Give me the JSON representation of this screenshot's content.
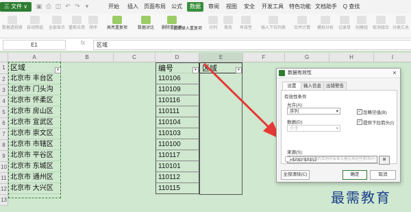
{
  "titlebar": {
    "file_menu": "三 文件 ∨",
    "tabs": [
      {
        "label": "开始"
      },
      {
        "label": "插入"
      },
      {
        "label": "页面布局"
      },
      {
        "label": "公式"
      },
      {
        "label": "数据"
      },
      {
        "label": "审阅"
      },
      {
        "label": "视图"
      },
      {
        "label": "安全"
      },
      {
        "label": "开发工具"
      },
      {
        "label": "特色功能"
      },
      {
        "label": "文档助手"
      },
      {
        "label": "Q 查找"
      }
    ]
  },
  "ribbon": {
    "items": [
      "数据透视表",
      "自动筛选",
      "全部显示",
      "重新应用",
      "排序",
      "高亮重复项",
      "数据对比",
      "删除重复项",
      "拒绝录入重复项",
      "分列",
      "填充",
      "有效性",
      "插入下拉列表",
      "合并计算",
      "模拟分析",
      "记录单",
      "创建组",
      "取消组合",
      "分类汇总"
    ]
  },
  "formula_bar": {
    "name_box": "E1",
    "fx": "fx",
    "formula": "区域"
  },
  "columns": [
    "A",
    "B",
    "C",
    "D",
    "E",
    "F",
    "G",
    "H",
    "I"
  ],
  "rows": [
    "1",
    "2",
    "3",
    "4",
    "5",
    "6",
    "7",
    "8",
    "9",
    "10",
    "11",
    "12",
    "13"
  ],
  "column_a": [
    "区域",
    "北京市  丰台区",
    "北京市  门头沟",
    "北京市  怀柔区",
    "北京市  房山区",
    "北京市  宣武区",
    "北京市  崇文区",
    "北京市  市辖区",
    "北京市  平谷区",
    "北京市  东城区",
    "北京市  通州区",
    "北京市  大兴区"
  ],
  "column_d": [
    "编号",
    "110106",
    "110109",
    "110116",
    "110111",
    "110104",
    "110103",
    "110100",
    "110117",
    "110101",
    "110112",
    "110115"
  ],
  "column_e": [
    "区域"
  ],
  "dialog": {
    "title": "数据有效性",
    "close": "×",
    "tabs": [
      {
        "label": "设置"
      },
      {
        "label": "输入信息"
      },
      {
        "label": "出错警告"
      }
    ],
    "section": "有效性条件",
    "allow_label": "允许(A):",
    "allow_value": "序列",
    "ignore_blank": "忽略空值(B)",
    "data_label": "数据(D):",
    "data_value": "介于",
    "dropdown": "提供下拉箭头(I)",
    "source_label": "来源(S):",
    "source_value": "=$A$2:$A$12",
    "apply_all": "对所有同样设置的其他所有单元格应用这些更改(P)",
    "clear_button": "全部清除(C)",
    "ok_button": "确定",
    "cancel_button": "取消"
  },
  "watermark": "最需教育",
  "colors": {
    "accent": "#2e7d32",
    "arrow": "#e53935",
    "sheet": "#c8e6c9"
  }
}
